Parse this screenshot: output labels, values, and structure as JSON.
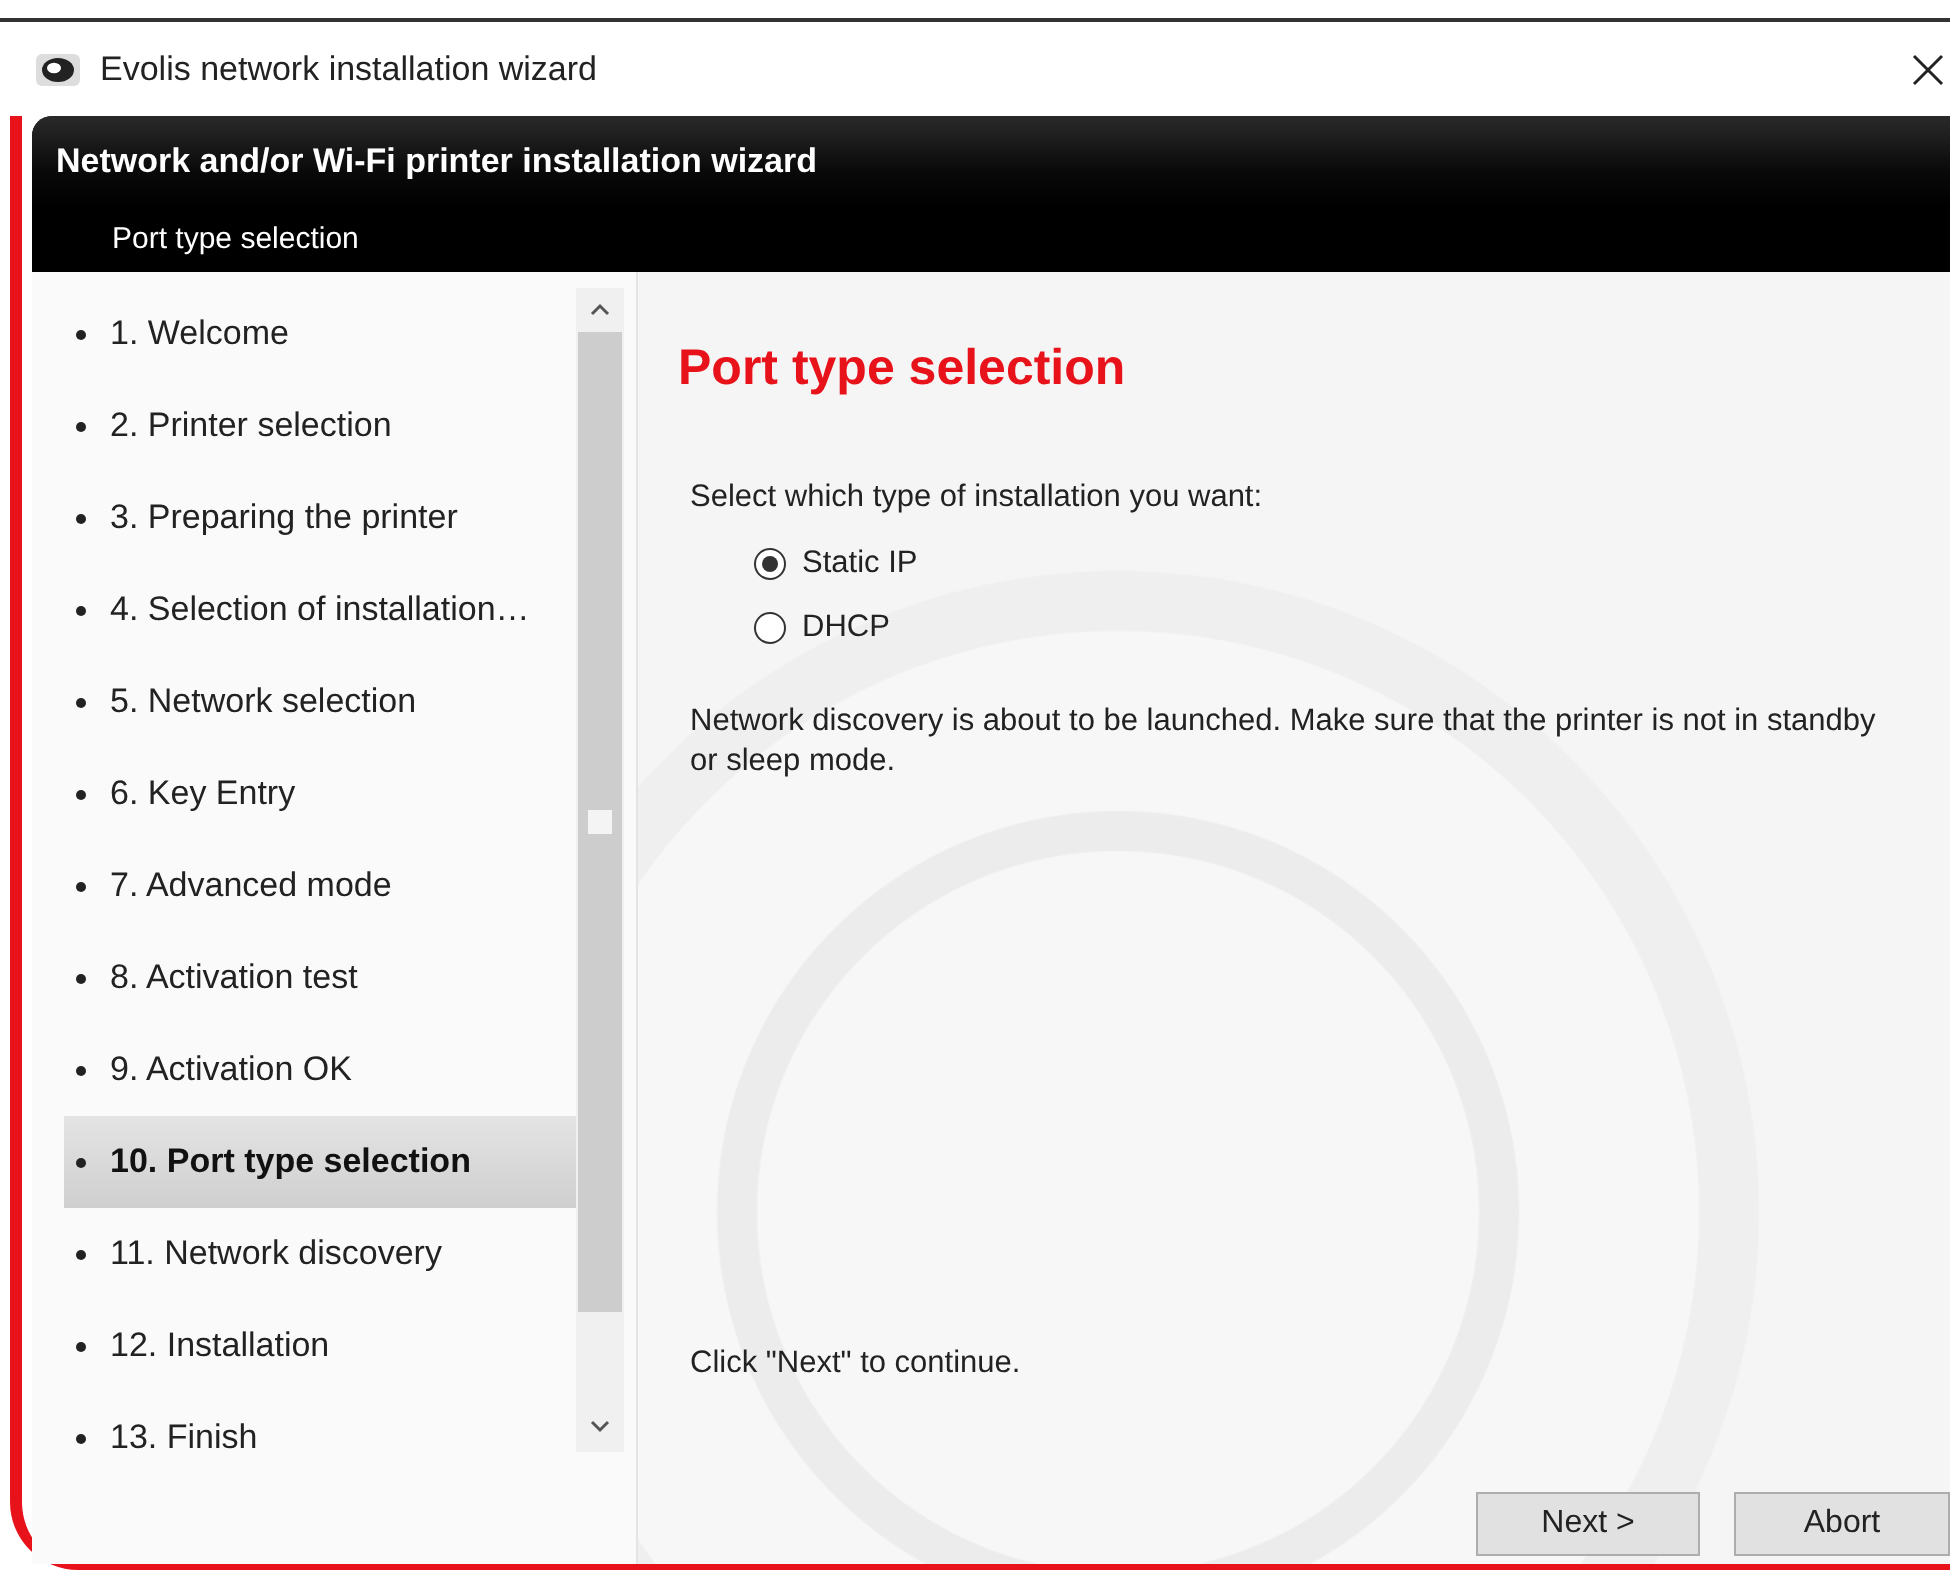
{
  "window": {
    "title": "Evolis network installation wizard"
  },
  "header": {
    "title": "Network and/or Wi-Fi printer installation wizard",
    "subtitle": "Port type selection"
  },
  "steps": [
    {
      "label": "1. Welcome",
      "selected": false
    },
    {
      "label": "2. Printer selection",
      "selected": false
    },
    {
      "label": "3. Preparing the printer",
      "selected": false
    },
    {
      "label": "4. Selection of installation…",
      "selected": false
    },
    {
      "label": "5. Network selection",
      "selected": false
    },
    {
      "label": "6. Key Entry",
      "selected": false
    },
    {
      "label": "7. Advanced mode",
      "selected": false
    },
    {
      "label": "8. Activation test",
      "selected": false
    },
    {
      "label": "9. Activation OK",
      "selected": false
    },
    {
      "label": "10. Port type selection",
      "selected": true
    },
    {
      "label": "11. Network discovery",
      "selected": false
    },
    {
      "label": "12. Installation",
      "selected": false
    },
    {
      "label": "13. Finish",
      "selected": false
    }
  ],
  "content": {
    "heading": "Port type selection",
    "prompt": "Select which type of installation you want:",
    "options": [
      {
        "label": "Static IP",
        "selected": true
      },
      {
        "label": "DHCP",
        "selected": false
      }
    ],
    "notice": "Network discovery is about to be launched. Make sure that the printer is not in standby or sleep mode.",
    "footer": "Click \"Next\" to continue."
  },
  "buttons": [
    "Next >",
    "Abort"
  ]
}
